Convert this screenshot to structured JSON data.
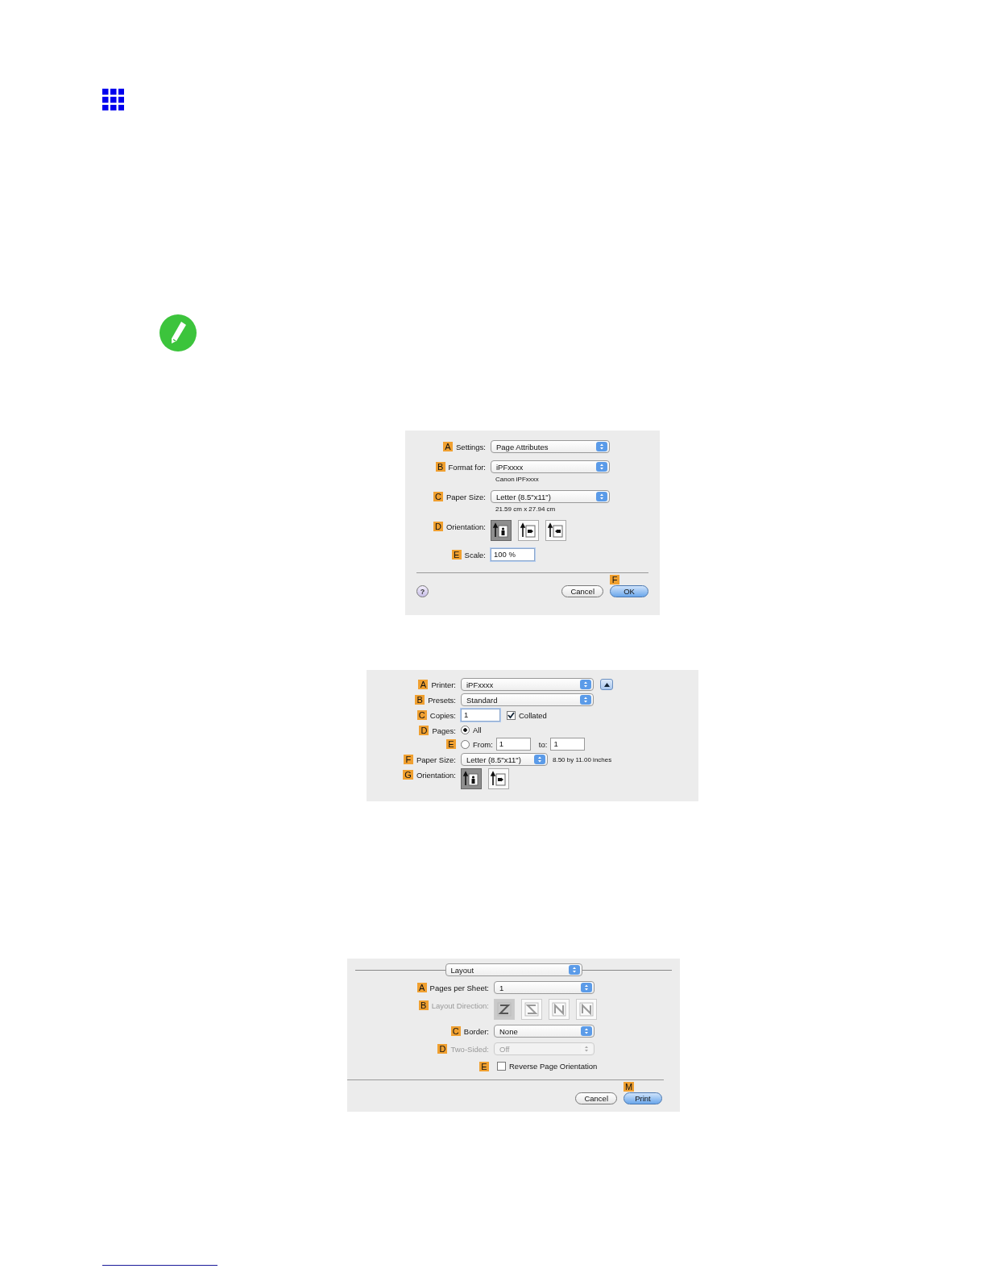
{
  "dialogs": [
    {
      "rows": [
        {
          "letter": "A",
          "label": "Settings:",
          "kind": "dropdown",
          "value": "Page Attributes"
        },
        {
          "letter": "B",
          "label": "Format for:",
          "kind": "dropdown",
          "value": "iPFxxxx",
          "caption": "Canon iPFxxxx"
        },
        {
          "letter": "C",
          "label": "Paper Size:",
          "kind": "dropdown",
          "value": "Letter (8.5\"x11\")",
          "caption": "21.59 cm x 27.94 cm"
        },
        {
          "letter": "D",
          "label": "Orientation:",
          "kind": "orientation",
          "options": [
            {
              "kind": "portrait",
              "selected": true
            },
            {
              "kind": "landscape",
              "selected": false
            },
            {
              "kind": "landscape_reverse",
              "selected": false
            }
          ]
        },
        {
          "letter": "E",
          "label": "Scale:",
          "kind": "field",
          "value": "100 %"
        }
      ],
      "footer": {
        "help": "?",
        "buttons": [
          {
            "label": "Cancel",
            "default": false
          },
          {
            "label": "OK",
            "default": true,
            "letter": "F"
          }
        ]
      }
    },
    {
      "rows": [
        {
          "letter": "A",
          "label": "Printer:",
          "kind": "dropdown",
          "value": "iPFxxxx",
          "disclosure": true
        },
        {
          "letter": "B",
          "label": "Presets:",
          "kind": "dropdown",
          "value": "Standard"
        },
        {
          "letter": "C",
          "label": "Copies:",
          "kind": "field",
          "value": "1",
          "checkbox": {
            "label": "Collated",
            "checked": true
          }
        },
        {
          "letter": "D",
          "label": "Pages:",
          "kind": "radio",
          "radio": {
            "label": "All",
            "selected": true
          }
        },
        {
          "letter": "E",
          "kind": "radio",
          "radio": {
            "label": "From:",
            "selected": false
          },
          "from": "1",
          "to_label": "to:",
          "to": "1"
        },
        {
          "letter": "F",
          "label": "Paper Size:",
          "kind": "dropdown",
          "value": "Letter (8.5\"x11\")",
          "note": "8.50 by 11.00 inches"
        },
        {
          "letter": "G",
          "label": "Orientation:",
          "kind": "orientation",
          "options": [
            {
              "kind": "portrait",
              "selected": true
            },
            {
              "kind": "landscape",
              "selected": false
            }
          ]
        }
      ]
    },
    {
      "header": "Layout",
      "rows": [
        {
          "letter": "A",
          "label": "Pages per Sheet:",
          "kind": "dropdown",
          "value": "1",
          "disabled": false
        },
        {
          "letter": "B",
          "label": "Layout Direction:",
          "kind": "direction",
          "disabled": true,
          "options": [
            {
              "kind": "z",
              "selected": true
            },
            {
              "kind": "s_reverse",
              "selected": false
            },
            {
              "kind": "n_reverse",
              "selected": false
            },
            {
              "kind": "n",
              "selected": false
            }
          ]
        },
        {
          "letter": "C",
          "label": "Border:",
          "kind": "dropdown",
          "value": "None",
          "disabled": false
        },
        {
          "letter": "D",
          "label": "Two-Sided:",
          "kind": "dropdown",
          "value": "Off",
          "disabled": true
        },
        {
          "letter": "E",
          "kind": "checkbox",
          "checkbox": {
            "label": "Reverse Page Orientation",
            "checked": false
          },
          "disabled": false
        }
      ],
      "footer": {
        "buttons": [
          {
            "label": "Cancel",
            "default": false
          },
          {
            "label": "Print",
            "default": true,
            "letter": "M"
          }
        ]
      }
    }
  ]
}
